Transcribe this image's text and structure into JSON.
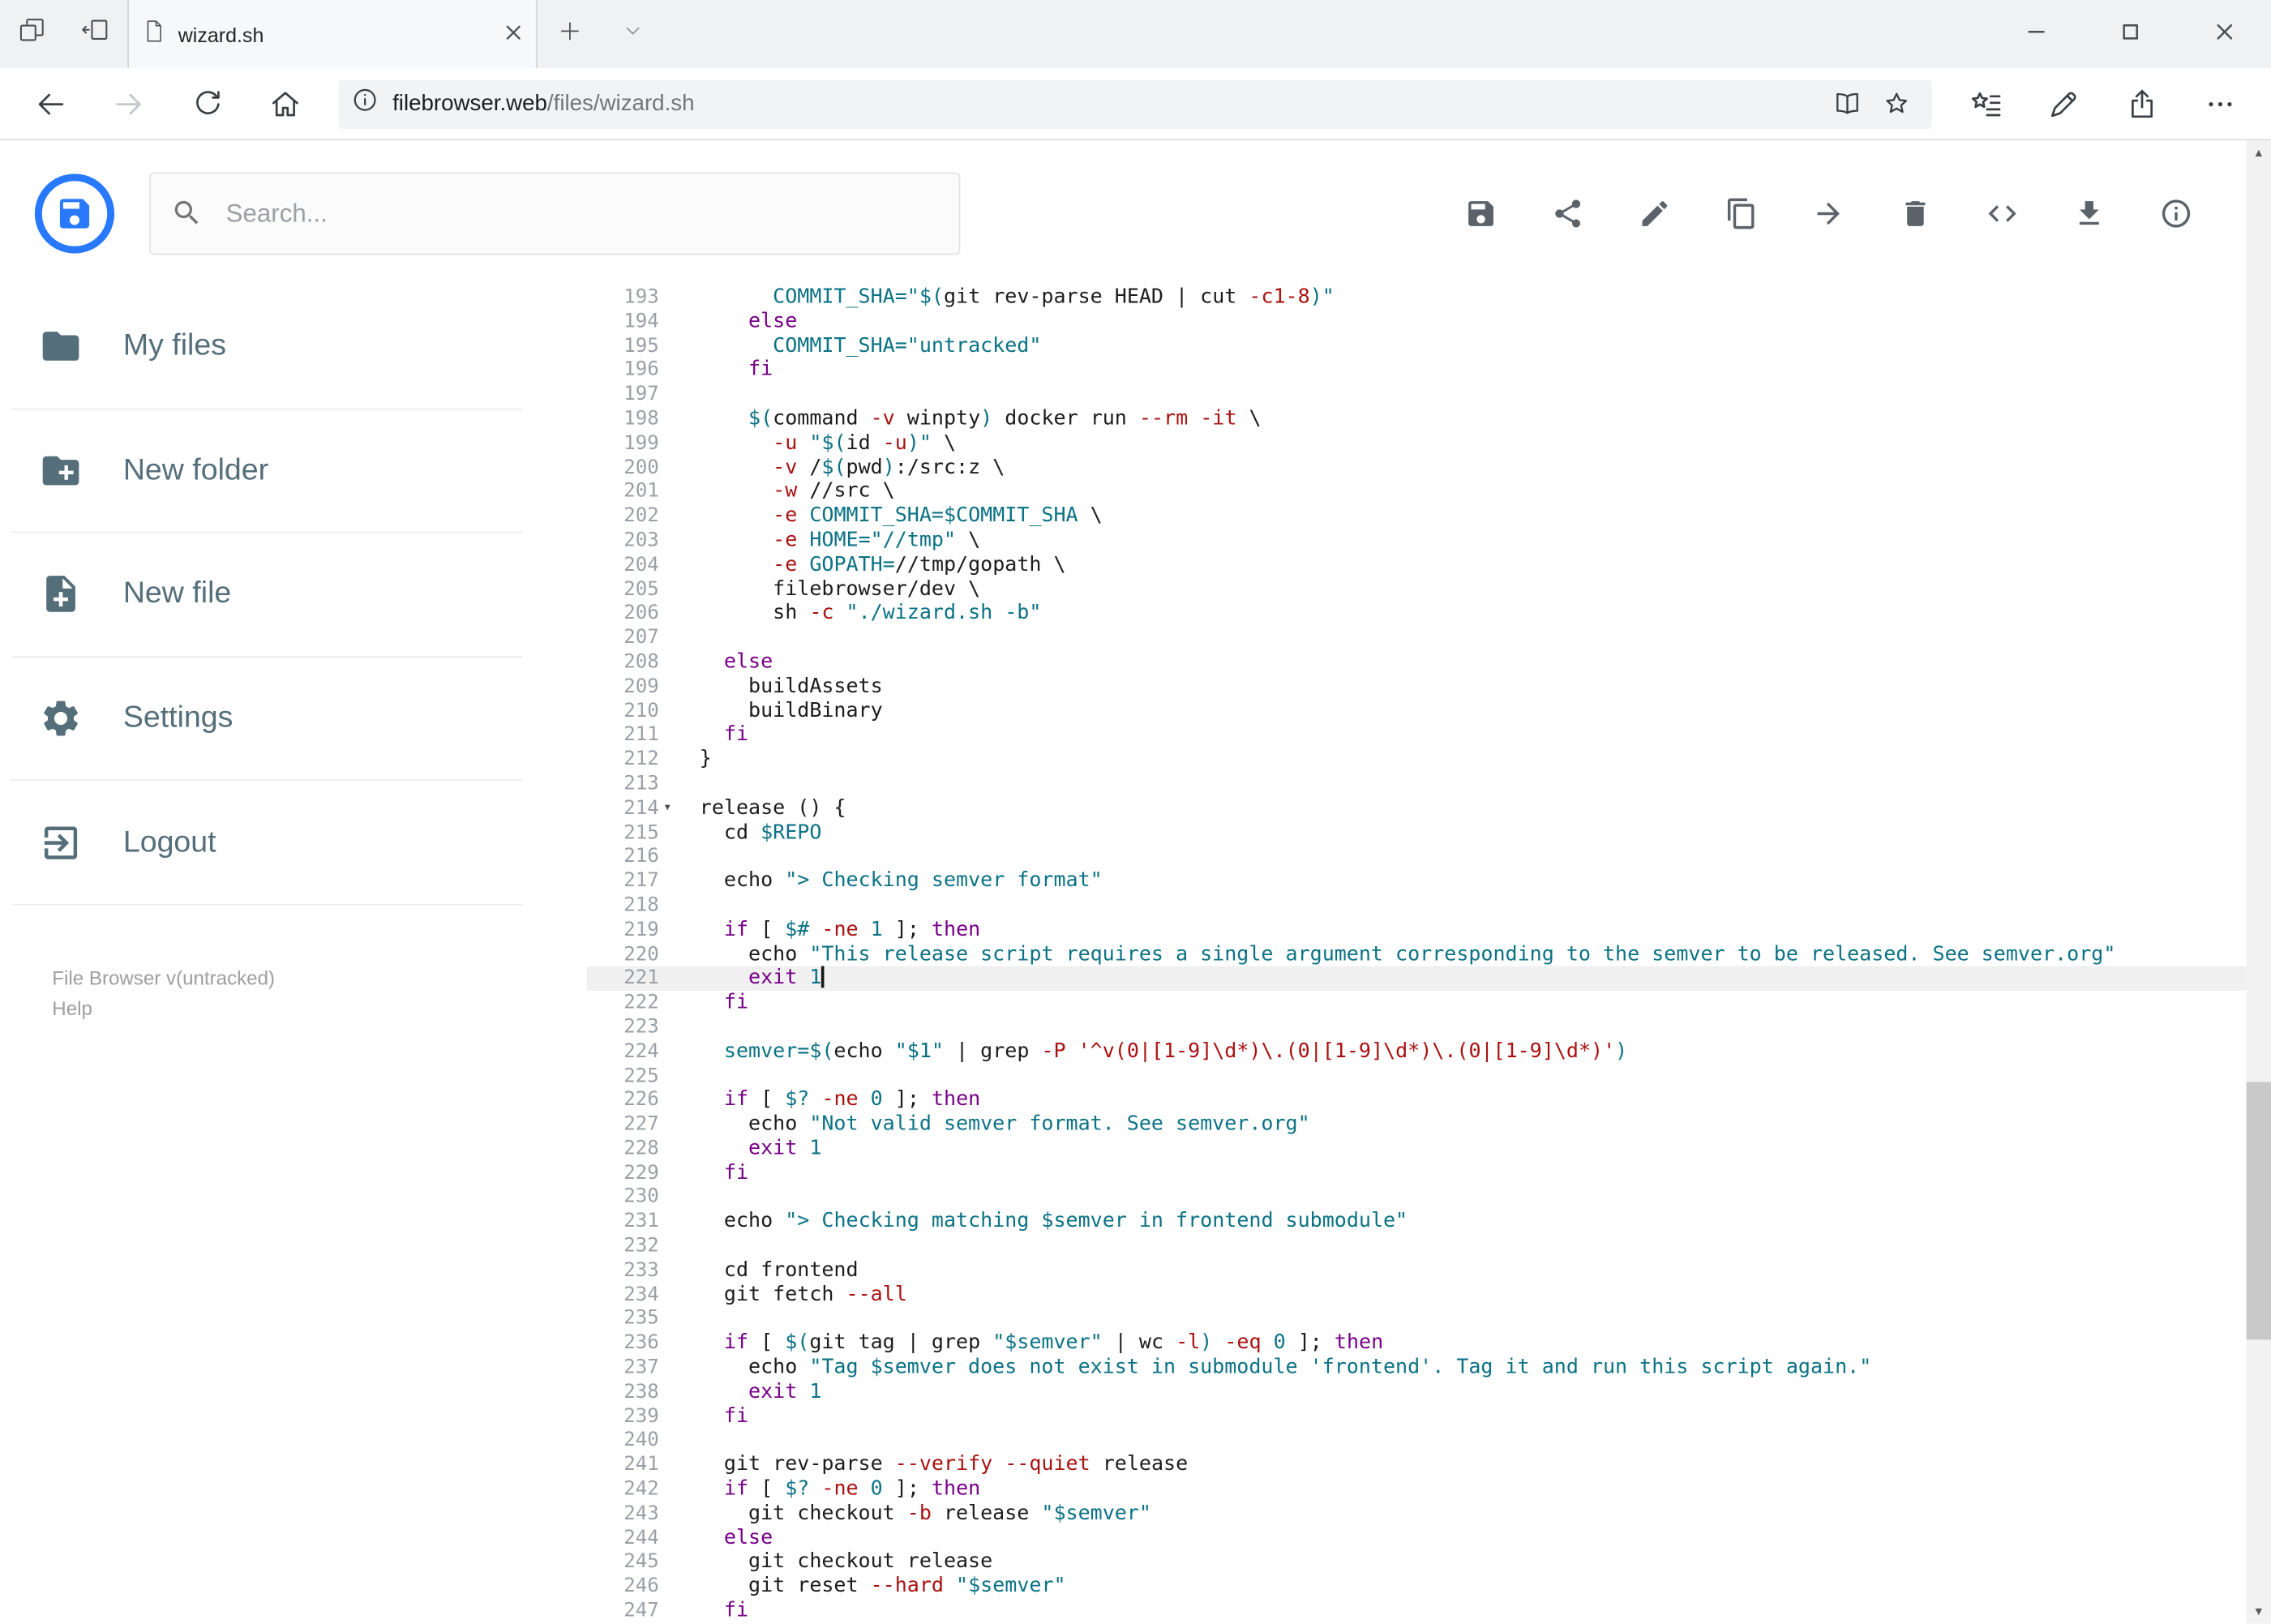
{
  "browser": {
    "tab_title": "wizard.sh",
    "url_host": "filebrowser.web",
    "url_path": "/files/wizard.sh"
  },
  "header": {
    "search_placeholder": "Search...",
    "toolbar_icons": [
      "save",
      "share",
      "edit",
      "copy",
      "move",
      "delete",
      "code",
      "download",
      "info"
    ]
  },
  "sidebar": {
    "items": [
      {
        "label": "My files",
        "icon": "folder"
      },
      {
        "label": "New folder",
        "icon": "create-new-folder"
      },
      {
        "label": "New file",
        "icon": "new-file"
      },
      {
        "label": "Settings",
        "icon": "settings-gear"
      },
      {
        "label": "Logout",
        "icon": "logout"
      }
    ],
    "footer_version": "File Browser v(untracked)",
    "footer_help": "Help"
  },
  "colors": {
    "accent_blue": "#2979ff",
    "sidebar_text": "#546e7a",
    "syntax_keyword": "#770088",
    "syntax_string_flag": "#aa1111",
    "syntax_variable": "#0b7285",
    "active_line_bg": "#f0f0f0"
  },
  "editor": {
    "active_line": 221,
    "fold_line": 214,
    "lines": [
      {
        "n": 193,
        "t": [
          [
            "p",
            "      "
          ],
          [
            "v",
            "COMMIT_SHA="
          ],
          [
            "v",
            "\"$("
          ],
          [
            "p",
            "git rev-parse HEAD | cut "
          ],
          [
            "s",
            "-c1-8"
          ],
          [
            "v",
            ")\""
          ]
        ]
      },
      {
        "n": 194,
        "t": [
          [
            "p",
            "    "
          ],
          [
            "k",
            "else"
          ]
        ]
      },
      {
        "n": 195,
        "t": [
          [
            "p",
            "      "
          ],
          [
            "v",
            "COMMIT_SHA="
          ],
          [
            "v",
            "\"untracked\""
          ]
        ]
      },
      {
        "n": 196,
        "t": [
          [
            "p",
            "    "
          ],
          [
            "k",
            "fi"
          ]
        ]
      },
      {
        "n": 197,
        "t": []
      },
      {
        "n": 198,
        "t": [
          [
            "p",
            "    "
          ],
          [
            "v",
            "$("
          ],
          [
            "p",
            "command "
          ],
          [
            "s",
            "-v"
          ],
          [
            "p",
            " winpty"
          ],
          [
            "v",
            ")"
          ],
          [
            "p",
            " docker run "
          ],
          [
            "s",
            "--rm"
          ],
          [
            "p",
            " "
          ],
          [
            "s",
            "-it"
          ],
          [
            "p",
            " \\"
          ]
        ]
      },
      {
        "n": 199,
        "t": [
          [
            "p",
            "      "
          ],
          [
            "s",
            "-u"
          ],
          [
            "p",
            " "
          ],
          [
            "v",
            "\"$("
          ],
          [
            "p",
            "id "
          ],
          [
            "s",
            "-u"
          ],
          [
            "v",
            ")\""
          ],
          [
            "p",
            " \\"
          ]
        ]
      },
      {
        "n": 200,
        "t": [
          [
            "p",
            "      "
          ],
          [
            "s",
            "-v"
          ],
          [
            "p",
            " /"
          ],
          [
            "v",
            "$("
          ],
          [
            "p",
            "pwd"
          ],
          [
            "v",
            ")"
          ],
          [
            "p",
            ":/src:z \\"
          ]
        ]
      },
      {
        "n": 201,
        "t": [
          [
            "p",
            "      "
          ],
          [
            "s",
            "-w"
          ],
          [
            "p",
            " //src \\"
          ]
        ]
      },
      {
        "n": 202,
        "t": [
          [
            "p",
            "      "
          ],
          [
            "s",
            "-e"
          ],
          [
            "p",
            " "
          ],
          [
            "v",
            "COMMIT_SHA=$COMMIT_SHA"
          ],
          [
            "p",
            " \\"
          ]
        ]
      },
      {
        "n": 203,
        "t": [
          [
            "p",
            "      "
          ],
          [
            "s",
            "-e"
          ],
          [
            "p",
            " "
          ],
          [
            "v",
            "HOME="
          ],
          [
            "v",
            "\"//tmp\""
          ],
          [
            "p",
            " \\"
          ]
        ]
      },
      {
        "n": 204,
        "t": [
          [
            "p",
            "      "
          ],
          [
            "s",
            "-e"
          ],
          [
            "p",
            " "
          ],
          [
            "v",
            "GOPATH="
          ],
          [
            "p",
            "//tmp/gopath \\"
          ]
        ]
      },
      {
        "n": 205,
        "t": [
          [
            "p",
            "      filebrowser/dev \\"
          ]
        ]
      },
      {
        "n": 206,
        "t": [
          [
            "p",
            "      sh "
          ],
          [
            "s",
            "-c"
          ],
          [
            "p",
            " "
          ],
          [
            "v",
            "\"./wizard.sh -b\""
          ]
        ]
      },
      {
        "n": 207,
        "t": []
      },
      {
        "n": 208,
        "t": [
          [
            "p",
            "  "
          ],
          [
            "k",
            "else"
          ]
        ]
      },
      {
        "n": 209,
        "t": [
          [
            "p",
            "    buildAssets"
          ]
        ]
      },
      {
        "n": 210,
        "t": [
          [
            "p",
            "    buildBinary"
          ]
        ]
      },
      {
        "n": 211,
        "t": [
          [
            "p",
            "  "
          ],
          [
            "k",
            "fi"
          ]
        ]
      },
      {
        "n": 212,
        "t": [
          [
            "p",
            "}"
          ]
        ]
      },
      {
        "n": 213,
        "t": []
      },
      {
        "n": 214,
        "t": [
          [
            "p",
            "release () {"
          ]
        ]
      },
      {
        "n": 215,
        "t": [
          [
            "p",
            "  cd "
          ],
          [
            "v",
            "$REPO"
          ]
        ]
      },
      {
        "n": 216,
        "t": []
      },
      {
        "n": 217,
        "t": [
          [
            "p",
            "  echo "
          ],
          [
            "v",
            "\"> Checking semver format\""
          ]
        ]
      },
      {
        "n": 218,
        "t": []
      },
      {
        "n": 219,
        "t": [
          [
            "p",
            "  "
          ],
          [
            "k",
            "if"
          ],
          [
            "p",
            " [ "
          ],
          [
            "v",
            "$#"
          ],
          [
            "p",
            " "
          ],
          [
            "s",
            "-ne"
          ],
          [
            "p",
            " "
          ],
          [
            "v",
            "1"
          ],
          [
            "p",
            " ]; "
          ],
          [
            "k",
            "then"
          ]
        ]
      },
      {
        "n": 220,
        "t": [
          [
            "p",
            "    echo "
          ],
          [
            "v",
            "\"This release script requires a single argument corresponding to the semver to be released. See semver.org\""
          ]
        ]
      },
      {
        "n": 221,
        "t": [
          [
            "p",
            "    "
          ],
          [
            "k",
            "exit"
          ],
          [
            "p",
            " "
          ],
          [
            "v",
            "1"
          ]
        ]
      },
      {
        "n": 222,
        "t": [
          [
            "p",
            "  "
          ],
          [
            "k",
            "fi"
          ]
        ]
      },
      {
        "n": 223,
        "t": []
      },
      {
        "n": 224,
        "t": [
          [
            "p",
            "  "
          ],
          [
            "v",
            "semver=$("
          ],
          [
            "p",
            "echo "
          ],
          [
            "v",
            "\"$1\""
          ],
          [
            "p",
            " | grep "
          ],
          [
            "s",
            "-P"
          ],
          [
            "p",
            " "
          ],
          [
            "s",
            "'^v(0|[1-9]\\d*)\\.(0|[1-9]\\d*)\\.(0|[1-9]\\d*)'"
          ],
          [
            "v",
            ")"
          ]
        ]
      },
      {
        "n": 225,
        "t": []
      },
      {
        "n": 226,
        "t": [
          [
            "p",
            "  "
          ],
          [
            "k",
            "if"
          ],
          [
            "p",
            " [ "
          ],
          [
            "v",
            "$?"
          ],
          [
            "p",
            " "
          ],
          [
            "s",
            "-ne"
          ],
          [
            "p",
            " "
          ],
          [
            "v",
            "0"
          ],
          [
            "p",
            " ]; "
          ],
          [
            "k",
            "then"
          ]
        ]
      },
      {
        "n": 227,
        "t": [
          [
            "p",
            "    echo "
          ],
          [
            "v",
            "\"Not valid semver format. See semver.org\""
          ]
        ]
      },
      {
        "n": 228,
        "t": [
          [
            "p",
            "    "
          ],
          [
            "k",
            "exit"
          ],
          [
            "p",
            " "
          ],
          [
            "v",
            "1"
          ]
        ]
      },
      {
        "n": 229,
        "t": [
          [
            "p",
            "  "
          ],
          [
            "k",
            "fi"
          ]
        ]
      },
      {
        "n": 230,
        "t": []
      },
      {
        "n": 231,
        "t": [
          [
            "p",
            "  echo "
          ],
          [
            "v",
            "\"> Checking matching $semver in frontend submodule\""
          ]
        ]
      },
      {
        "n": 232,
        "t": []
      },
      {
        "n": 233,
        "t": [
          [
            "p",
            "  cd frontend"
          ]
        ]
      },
      {
        "n": 234,
        "t": [
          [
            "p",
            "  git fetch "
          ],
          [
            "s",
            "--all"
          ]
        ]
      },
      {
        "n": 235,
        "t": []
      },
      {
        "n": 236,
        "t": [
          [
            "p",
            "  "
          ],
          [
            "k",
            "if"
          ],
          [
            "p",
            " [ "
          ],
          [
            "v",
            "$("
          ],
          [
            "p",
            "git tag | grep "
          ],
          [
            "v",
            "\"$semver\""
          ],
          [
            "p",
            " | wc "
          ],
          [
            "s",
            "-l"
          ],
          [
            "v",
            ")"
          ],
          [
            "p",
            " "
          ],
          [
            "s",
            "-eq"
          ],
          [
            "p",
            " "
          ],
          [
            "v",
            "0"
          ],
          [
            "p",
            " ]; "
          ],
          [
            "k",
            "then"
          ]
        ]
      },
      {
        "n": 237,
        "t": [
          [
            "p",
            "    echo "
          ],
          [
            "v",
            "\"Tag $semver does not exist in submodule 'frontend'. Tag it and run this script again.\""
          ]
        ]
      },
      {
        "n": 238,
        "t": [
          [
            "p",
            "    "
          ],
          [
            "k",
            "exit"
          ],
          [
            "p",
            " "
          ],
          [
            "v",
            "1"
          ]
        ]
      },
      {
        "n": 239,
        "t": [
          [
            "p",
            "  "
          ],
          [
            "k",
            "fi"
          ]
        ]
      },
      {
        "n": 240,
        "t": []
      },
      {
        "n": 241,
        "t": [
          [
            "p",
            "  git rev-parse "
          ],
          [
            "s",
            "--verify"
          ],
          [
            "p",
            " "
          ],
          [
            "s",
            "--quiet"
          ],
          [
            "p",
            " release"
          ]
        ]
      },
      {
        "n": 242,
        "t": [
          [
            "p",
            "  "
          ],
          [
            "k",
            "if"
          ],
          [
            "p",
            " [ "
          ],
          [
            "v",
            "$?"
          ],
          [
            "p",
            " "
          ],
          [
            "s",
            "-ne"
          ],
          [
            "p",
            " "
          ],
          [
            "v",
            "0"
          ],
          [
            "p",
            " ]; "
          ],
          [
            "k",
            "then"
          ]
        ]
      },
      {
        "n": 243,
        "t": [
          [
            "p",
            "    git checkout "
          ],
          [
            "s",
            "-b"
          ],
          [
            "p",
            " release "
          ],
          [
            "v",
            "\"$semver\""
          ]
        ]
      },
      {
        "n": 244,
        "t": [
          [
            "p",
            "  "
          ],
          [
            "k",
            "else"
          ]
        ]
      },
      {
        "n": 245,
        "t": [
          [
            "p",
            "    git checkout release"
          ]
        ]
      },
      {
        "n": 246,
        "t": [
          [
            "p",
            "    git reset "
          ],
          [
            "s",
            "--hard"
          ],
          [
            "p",
            " "
          ],
          [
            "v",
            "\"$semver\""
          ]
        ]
      },
      {
        "n": 247,
        "t": [
          [
            "p",
            "  "
          ],
          [
            "k",
            "fi"
          ]
        ]
      }
    ]
  }
}
